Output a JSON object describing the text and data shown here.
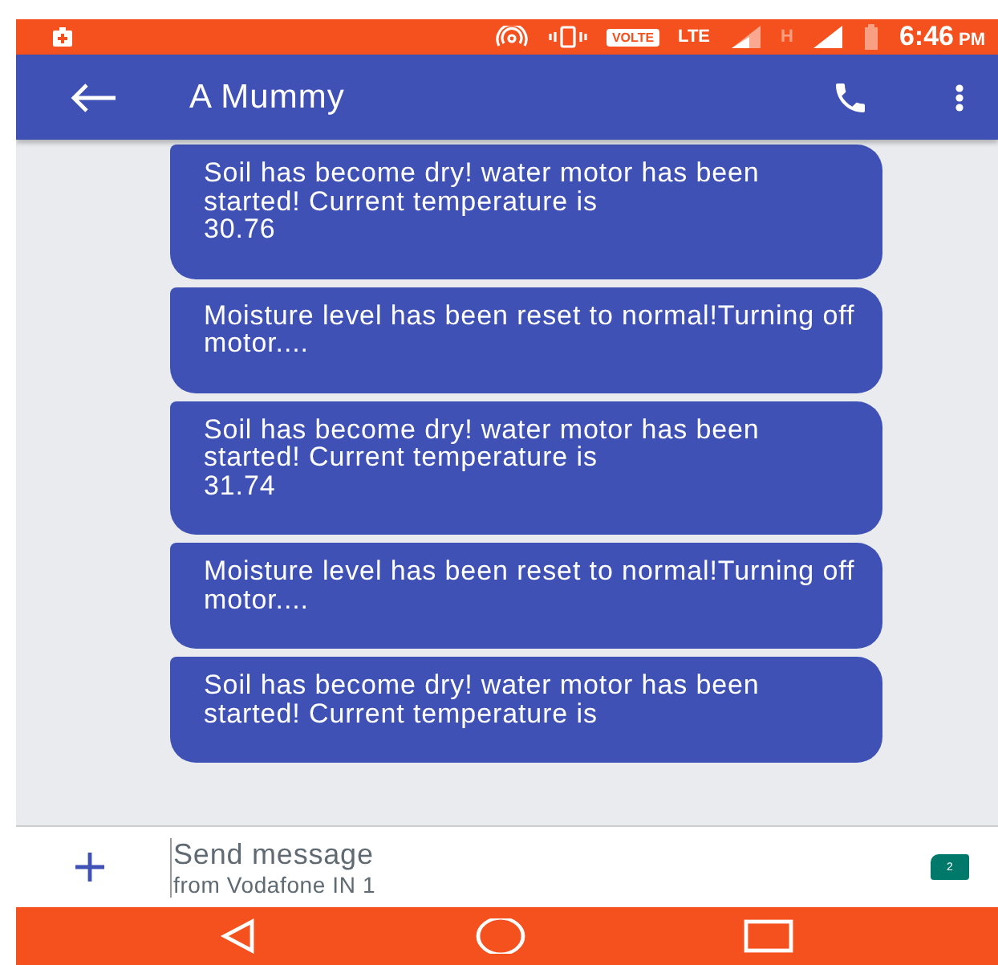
{
  "status_bar": {
    "volte": "VOLTE",
    "network": "LTE",
    "secondary_network": "H",
    "time": "6:46",
    "meridiem": "PM"
  },
  "app_bar": {
    "title": "A Mummy"
  },
  "messages": [
    {
      "text": "Soil has become dry! water motor has been started! Current temperature is\n30.76"
    },
    {
      "text": "Moisture level has been reset to normal!Turning off motor...."
    },
    {
      "text": "Soil has become dry! water motor has been started! Current temperature is\n31.74"
    },
    {
      "text": "Moisture level has been reset to normal!Turning off motor...."
    },
    {
      "text": "Soil has become dry! water motor has been started! Current temperature is"
    }
  ],
  "composer": {
    "placeholder": "Send message",
    "sim_label": "from Vodafone IN 1",
    "sim_badge": "2"
  }
}
